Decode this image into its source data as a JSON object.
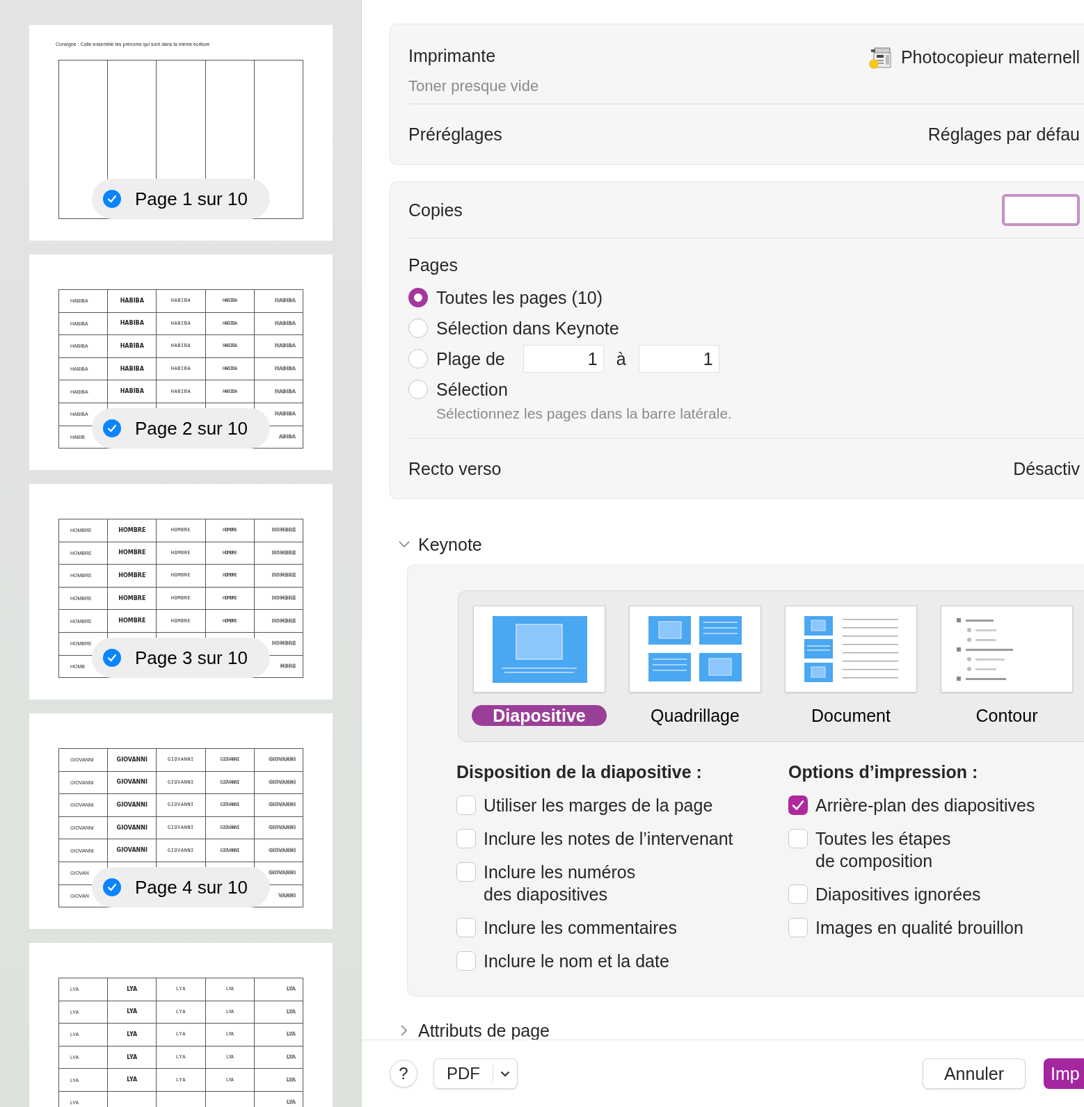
{
  "sidebar": {
    "thumbnails": [
      {
        "kind": "instruction_page",
        "instruction": "Consigne : Colle ensemble les prénoms qui sont dans la même écriture",
        "badge": "Page 1 sur 10",
        "checked": true
      },
      {
        "kind": "name_grid",
        "badge": "Page 2 sur 10",
        "checked": true,
        "rows": [
          [
            "HABIBA",
            "HABIBA",
            "HABIBA",
            "HABIBA",
            "HABIBA"
          ],
          [
            "HABIBA",
            "HABIBA",
            "HABIBA",
            "HABIBA",
            "HABIBA"
          ],
          [
            "HABIBA",
            "HABIBA",
            "HABIBA",
            "HABIBA",
            "HABIBA"
          ],
          [
            "HABIBA",
            "HABIBA",
            "HABIBA",
            "HABIBA",
            "HABIBA"
          ],
          [
            "HABIBA",
            "HABIBA",
            "HABIBA",
            "HABIBA",
            "HABIBA"
          ],
          [
            "HABIBA",
            null,
            null,
            null,
            "HABIBA"
          ],
          [
            "HABIB",
            null,
            null,
            null,
            "ABIBA"
          ]
        ]
      },
      {
        "kind": "name_grid",
        "badge": "Page 3 sur 10",
        "checked": true,
        "rows": [
          [
            "HOMBRE",
            "HOMBRE",
            "HOMBRE",
            "HOMBRE",
            "HOMBRE"
          ],
          [
            "HOMBRE",
            "HOMBRE",
            "HOMBRE",
            "HOMBRE",
            "HOMBRE"
          ],
          [
            "HOMBRE",
            "HOMBRE",
            "HOMBRE",
            "HOMBRE",
            "HOMBRE"
          ],
          [
            "HOMBRE",
            "HOMBRE",
            "HOMBRE",
            "HOMBRE",
            "HOMBRE"
          ],
          [
            "HOMBRE",
            "HOMBRE",
            "HOMBRE",
            "HOMBRE",
            "HOMBRE"
          ],
          [
            "HOMBRE",
            null,
            null,
            null,
            "HOMBRE"
          ],
          [
            "HOMB",
            null,
            null,
            null,
            "MBRE"
          ]
        ]
      },
      {
        "kind": "name_grid",
        "badge": "Page 4 sur 10",
        "checked": true,
        "rows": [
          [
            "GIOVANNI",
            "GIOVANNI",
            "GIOVANNI",
            "GIOVANNI",
            "GIOVANNI"
          ],
          [
            "GIOVANNI",
            "GIOVANNI",
            "GIOVANNI",
            "GIOVANNI",
            "GIOVANNI"
          ],
          [
            "GIOVANNI",
            "GIOVANNI",
            "GIOVANNI",
            "GIOVANNI",
            "GIOVANNI"
          ],
          [
            "GIOVANNI",
            "GIOVANNI",
            "GIOVANNI",
            "GIOVANNI",
            "GIOVANNI"
          ],
          [
            "GIOVANNI",
            "GIOVANNI",
            "GIOVANNI",
            "GIOVANNI",
            "GIOVANNI"
          ],
          [
            "GIOVAN",
            null,
            null,
            null,
            "GIOVANNI"
          ],
          [
            "GIOVAN",
            null,
            null,
            null,
            "VANNI"
          ]
        ]
      },
      {
        "kind": "name_grid",
        "rows": [
          [
            "LYA",
            "LYA",
            "LYA",
            "LYA",
            "LYA"
          ],
          [
            "LYA",
            "LYA",
            "LYA",
            "LYA",
            "LYA"
          ],
          [
            "LYA",
            "LYA",
            "LYA",
            "LYA",
            "LYA"
          ],
          [
            "LYA",
            "LYA",
            "LYA",
            "LYA",
            "LYA"
          ],
          [
            "LYA",
            "LYA",
            "LYA",
            "LYA",
            "LYA"
          ],
          [
            "LYA",
            null,
            null,
            null,
            "LYA"
          ]
        ]
      }
    ]
  },
  "printer": {
    "label": "Imprimante",
    "value": "Photocopieur maternell",
    "status": "Toner presque vide",
    "warning": true
  },
  "presets": {
    "label": "Préréglages",
    "value": "Réglages par défau"
  },
  "copies": {
    "label": "Copies",
    "focused": true
  },
  "pages": {
    "label": "Pages",
    "options": [
      {
        "kind": "plain",
        "label": "Toutes les pages (10)",
        "selected": true
      },
      {
        "kind": "plain",
        "label": "Sélection dans Keynote",
        "selected": false
      },
      {
        "kind": "range",
        "label": "Plage de",
        "selected": false,
        "from": "1",
        "to_label": "à",
        "to": "1"
      },
      {
        "kind": "with_note",
        "label": "Sélection",
        "selected": false,
        "note": "Sélectionnez les pages dans la barre latérale."
      }
    ]
  },
  "duplex": {
    "label": "Recto verso",
    "value": "Désactiv"
  },
  "keynote": {
    "title": "Keynote",
    "expanded": true,
    "layouts": [
      {
        "kind": "slide",
        "label": "Diapositive",
        "selected": true
      },
      {
        "kind": "grid",
        "label": "Quadrillage",
        "selected": false
      },
      {
        "kind": "document",
        "label": "Document",
        "selected": false
      },
      {
        "kind": "outline",
        "label": "Contour",
        "selected": false
      }
    ],
    "slide_layout": {
      "heading": "Disposition de la diapositive :",
      "options": [
        {
          "label": "Utiliser les marges de la page",
          "checked": false
        },
        {
          "label": "Inclure les notes de l’intervenant",
          "checked": false
        },
        {
          "label": "Inclure les numéros\ndes diapositives",
          "checked": false
        },
        {
          "label": "Inclure les commentaires",
          "checked": false
        },
        {
          "label": "Inclure le nom et la date",
          "checked": false
        }
      ]
    },
    "print_options": {
      "heading": "Options d’impression :",
      "options": [
        {
          "label": "Arrière-plan des diapositives",
          "checked": true
        },
        {
          "label": "Toutes les étapes\nde composition",
          "checked": false
        },
        {
          "label": "Diapositives ignorées",
          "checked": false
        },
        {
          "label": "Images en qualité brouillon",
          "checked": false
        }
      ]
    }
  },
  "page_attributes": {
    "title": "Attributs de page",
    "expanded": false
  },
  "footer": {
    "help": "?",
    "pdf": "PDF",
    "cancel": "Annuler",
    "print": "Imp"
  }
}
